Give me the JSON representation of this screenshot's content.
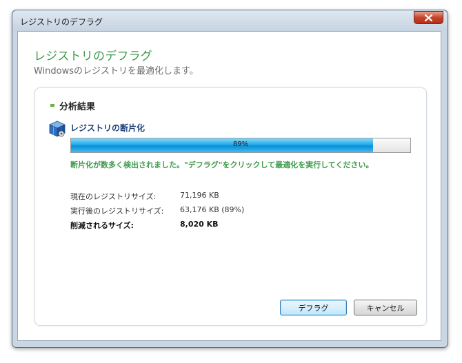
{
  "window": {
    "title": "レジストリのデフラグ"
  },
  "header": {
    "title": "レジストリのデフラグ",
    "subtitle": "Windowsのレジストリを最適化します。"
  },
  "panel": {
    "section_title": "分析結果",
    "fragmentation_label": "レジストリの断片化",
    "progress": {
      "percent": 89,
      "label": "89%"
    },
    "message": "断片化が数多く検出されました。\"デフラグ\"をクリックして最適化を実行してください。",
    "details": [
      {
        "label": "現在のレジストリサイズ:",
        "value": "71,196 KB",
        "bold": false
      },
      {
        "label": "実行後のレジストリサイズ:",
        "value": "63,176 KB (89%)",
        "bold": false
      },
      {
        "label": "削減されるサイズ:",
        "value": "8,020 KB",
        "bold": true
      }
    ]
  },
  "buttons": {
    "defrag": "デフラグ",
    "cancel": "キャンセル"
  },
  "icons": {
    "close": "close-icon",
    "registry": "registry-cube-icon"
  },
  "colors": {
    "accent_green": "#3c9a4a",
    "label_blue": "#1a3f7a",
    "progress_blue": "#22a9ea",
    "close_red": "#c7452c"
  }
}
